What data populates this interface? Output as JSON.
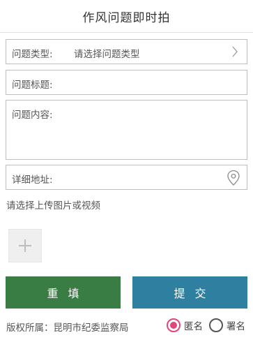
{
  "header": {
    "title": "作风问题即时拍"
  },
  "form": {
    "type_label": "问题类型:",
    "type_value": "请选择问题类型",
    "title_label": "问题标题:",
    "content_label": "问题内容:",
    "address_label": "详细地址:"
  },
  "media": {
    "hint": "请选择上传图片或视频"
  },
  "buttons": {
    "reset_label": "重填",
    "submit_label": "提交"
  },
  "footer": {
    "copyright": "版权所属：昆明市纪委监察局",
    "anonymous_label": "匿名",
    "named_label": "署名",
    "selected": "匿名"
  },
  "colors": {
    "reset_button": "#3a7d44",
    "submit_button": "#2f7fa0",
    "radio_selected": "#e0457b"
  },
  "icons": {
    "type_chevron": "chevron-right-icon",
    "address_pin": "location-pin-icon",
    "add_media": "plus-icon"
  }
}
